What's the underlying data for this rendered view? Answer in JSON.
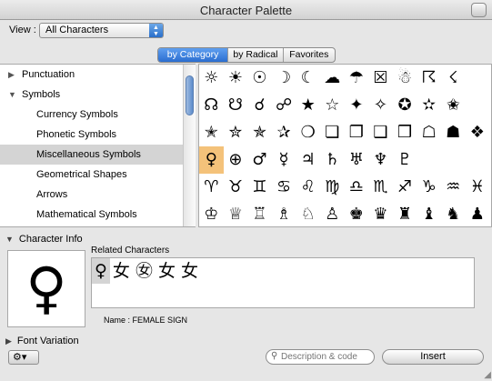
{
  "window": {
    "title": "Character Palette"
  },
  "view": {
    "label": "View :",
    "selected": "All Characters"
  },
  "tabs": [
    {
      "label": "by Category",
      "selected": true
    },
    {
      "label": "by Radical",
      "selected": false
    },
    {
      "label": "Favorites",
      "selected": false
    }
  ],
  "categories": [
    {
      "label": "Punctuation",
      "level": "top",
      "expanded": false,
      "selected": false
    },
    {
      "label": "Symbols",
      "level": "top",
      "expanded": true,
      "selected": false
    },
    {
      "label": "Currency Symbols",
      "level": "sub",
      "selected": false
    },
    {
      "label": "Phonetic Symbols",
      "level": "sub",
      "selected": false
    },
    {
      "label": "Miscellaneous Symbols",
      "level": "sub",
      "selected": true
    },
    {
      "label": "Geometrical Shapes",
      "level": "sub",
      "selected": false
    },
    {
      "label": "Arrows",
      "level": "sub",
      "selected": false
    },
    {
      "label": "Mathematical Symbols",
      "level": "sub",
      "selected": false
    }
  ],
  "grid": {
    "rows": [
      [
        "☼",
        "☀",
        "☉",
        "☽",
        "☾",
        "☁",
        "☂",
        "☒",
        "☃",
        "☈",
        "☇"
      ],
      [
        "☊",
        "☋",
        "☌",
        "☍",
        "★",
        "☆",
        "✦",
        "✧",
        "✪",
        "✫",
        "✬"
      ],
      [
        "✭",
        "✮",
        "✯",
        "✰",
        "❍",
        "❏",
        "❐",
        "❑",
        "❒",
        "☖",
        "☗",
        "❖"
      ],
      [
        "♀",
        "⊕",
        "♂",
        "☿",
        "♃",
        "♄",
        "♅",
        "♆",
        "♇"
      ],
      [
        "♈",
        "♉",
        "♊",
        "♋",
        "♌",
        "♍",
        "♎",
        "♏",
        "♐",
        "♑",
        "♒",
        "♓"
      ],
      [
        "♔",
        "♕",
        "♖",
        "♗",
        "♘",
        "♙",
        "♚",
        "♛",
        "♜",
        "♝",
        "♞",
        "♟"
      ]
    ],
    "selected_row": 3,
    "selected_col": 0
  },
  "character_info": {
    "header": "Character Info",
    "glyph": "♀",
    "related_label": "Related Characters",
    "related": [
      "♀",
      "女",
      "㊛",
      "⼥",
      "女"
    ],
    "related_selected": 0,
    "name_line": "Name :  FEMALE SIGN"
  },
  "font_variation": {
    "header": "Font Variation"
  },
  "bottom": {
    "search_placeholder": "Description & code",
    "insert_label": "Insert",
    "gear_icon": "⚙▾"
  }
}
